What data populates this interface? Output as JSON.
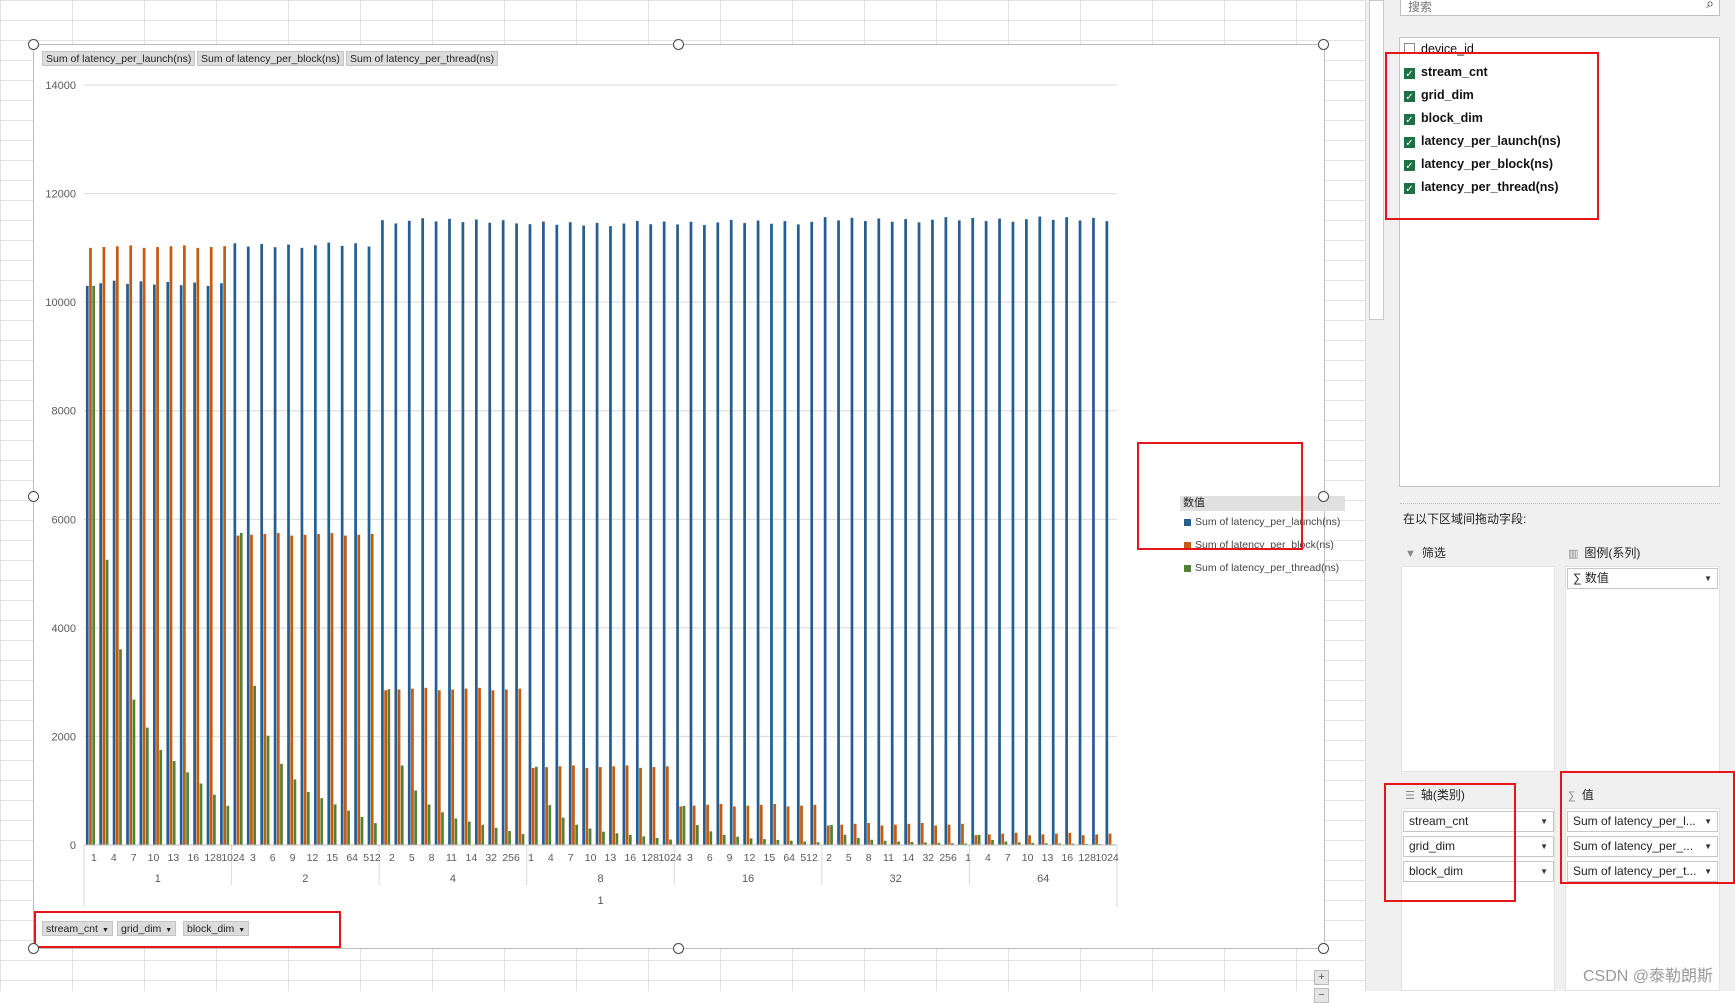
{
  "chart": {
    "field_buttons_top": [
      "Sum of latency_per_launch(ns)",
      "Sum of latency_per_block(ns)",
      "Sum of latency_per_thread(ns)"
    ],
    "field_buttons_bottom": [
      "stream_cnt",
      "grid_dim",
      "block_dim"
    ],
    "legend_title": "数值",
    "legend_items": [
      "Sum of latency_per_launch(ns)",
      "Sum of latency_per_block(ns)",
      "Sum of latency_per_thread(ns)"
    ],
    "zoom_plus": "+",
    "zoom_minus": "−"
  },
  "chart_data": {
    "type": "bar",
    "ylim": [
      0,
      14000
    ],
    "y_ticks": [
      0,
      2000,
      4000,
      6000,
      8000,
      10000,
      12000,
      14000
    ],
    "grid": true,
    "legend_position": "right",
    "axis_levels": [
      "stream_cnt",
      "grid_dim",
      "block_dim"
    ],
    "block_dim_tick_labels": [
      "1",
      "4",
      "7",
      "10",
      "13",
      "16",
      "128",
      "1024",
      "3",
      "6",
      "9",
      "12",
      "15",
      "64",
      "512",
      "2",
      "5",
      "8",
      "11",
      "14",
      "32",
      "256",
      "1",
      "4",
      "7",
      "10",
      "13",
      "16",
      "128",
      "1024",
      "3",
      "6",
      "9",
      "12",
      "15",
      "64",
      "512",
      "2",
      "5",
      "8",
      "11",
      "14",
      "32",
      "256",
      "1",
      "4",
      "7",
      "10",
      "13",
      "16",
      "128",
      "1024"
    ],
    "grid_dim_groups": [
      "1",
      "2",
      "4",
      "8",
      "16",
      "32",
      "64"
    ],
    "stream_cnt_groups": [
      "1"
    ],
    "series_colors": [
      "#255e91",
      "#c55a11",
      "#548235"
    ],
    "series": [
      {
        "name": "Sum of latency_per_launch(ns)",
        "approx_value_range": [
          10300,
          11550
        ]
      },
      {
        "name": "Sum of latency_per_block(ns)",
        "values_by_grid_dim": {
          "1": 11000,
          "2": 5700,
          "4": 2850,
          "8": 1420,
          "16": 710,
          "32": 360,
          "64": 180
        }
      },
      {
        "name": "Sum of latency_per_thread(ns)",
        "peak_values_by_grid_dim": {
          "1": 10300,
          "2": 5750,
          "4": 2870,
          "8": 1440,
          "16": 720,
          "32": 370,
          "64": 185
        }
      }
    ]
  },
  "pane": {
    "search_placeholder": "搜索",
    "search_icon": "search-icon",
    "fields": [
      {
        "label": "device_id",
        "checked": false
      },
      {
        "label": "stream_cnt",
        "checked": true
      },
      {
        "label": "grid_dim",
        "checked": true
      },
      {
        "label": "block_dim",
        "checked": true
      },
      {
        "label": "latency_per_launch(ns)",
        "checked": true
      },
      {
        "label": "latency_per_block(ns)",
        "checked": true
      },
      {
        "label": "latency_per_thread(ns)",
        "checked": true
      }
    ],
    "drag_hint": "在以下区域间拖动字段:",
    "filter_label": "筛选",
    "legend_series_label": "图例(系列)",
    "legend_series_item": "∑ 数值",
    "axis_label": "轴(类别)",
    "axis_items": [
      "stream_cnt",
      "grid_dim",
      "block_dim"
    ],
    "values_label": "值",
    "values_items": [
      "Sum of latency_per_l...",
      "Sum of latency_per_...",
      "Sum of latency_per_t..."
    ]
  },
  "watermark": "CSDN @泰勒朗斯"
}
